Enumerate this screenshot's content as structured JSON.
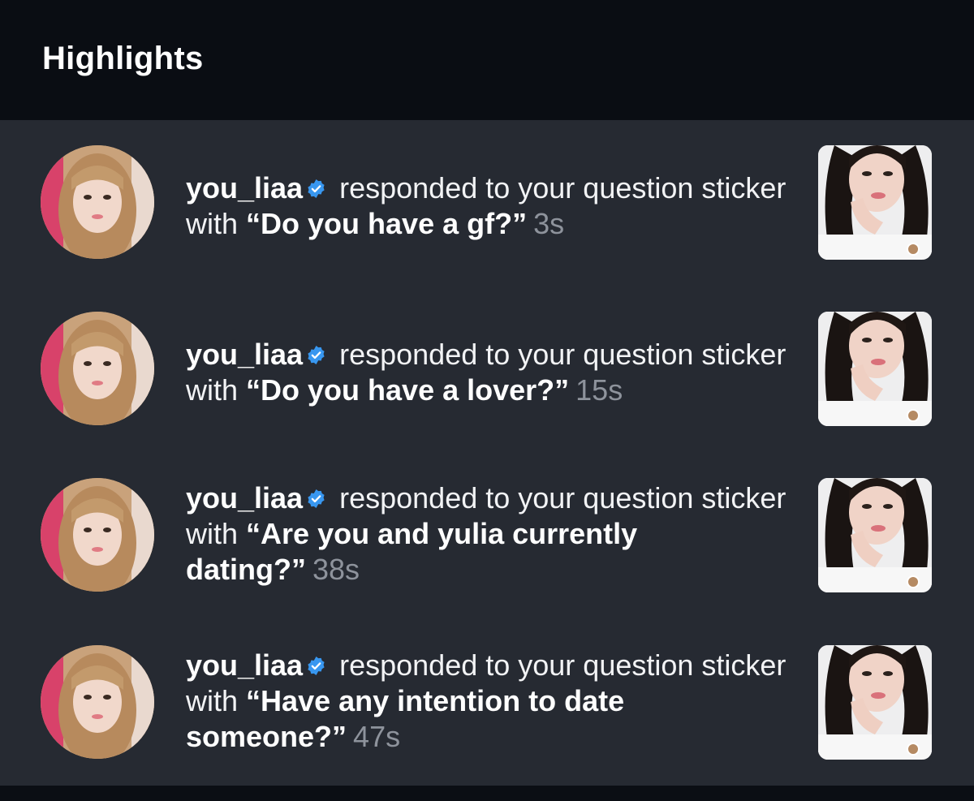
{
  "header": {
    "title": "Highlights"
  },
  "notifications": [
    {
      "username": "you_liaa",
      "action": "responded to your question sticker with",
      "quote": "“Do you have a gf?”",
      "time": "3s"
    },
    {
      "username": "you_liaa",
      "action": "responded to your question sticker with",
      "quote": "“Do you have a lover?”",
      "time": "15s"
    },
    {
      "username": "you_liaa",
      "action": "responded to your question sticker with",
      "quote": "“Are you and yulia currently dating?”",
      "time": "38s"
    },
    {
      "username": "you_liaa",
      "action": "responded to your question sticker with",
      "quote": "“Have any intention to date someone?”",
      "time": "47s"
    }
  ],
  "icons": {
    "verified": "verified-badge-icon",
    "avatar": "profile-avatar",
    "story": "story-thumbnail"
  },
  "colors": {
    "header_bg": "#0a0d13",
    "list_bg": "#262a32",
    "text": "#f2f3f5",
    "time": "#8e939c",
    "verified": "#3897f0"
  }
}
